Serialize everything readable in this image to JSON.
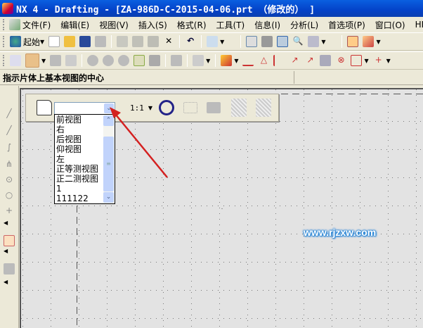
{
  "window": {
    "title": "NX 4 - Drafting - [ZA-986D-C-2015-04-06.prt （修改的） ]"
  },
  "menu": [
    "文件(F)",
    "编辑(E)",
    "视图(V)",
    "插入(S)",
    "格式(R)",
    "工具(T)",
    "信息(I)",
    "分析(L)",
    "首选项(P)",
    "窗口(O)",
    "HE"
  ],
  "toolbar": {
    "start_label": "起始"
  },
  "status": {
    "prompt": "指示片体上基本视图的中心"
  },
  "view_bar": {
    "scale": "1:1",
    "selected_view": "",
    "options": [
      "前视图",
      "右",
      "后视图",
      "仰视图",
      "左",
      "正等测视图",
      "正二测视图",
      "1",
      "111122"
    ]
  },
  "watermark": "www.rjzxw.com",
  "colors": {
    "title_bar": "#0a5fe0",
    "arrow": "#d42020",
    "canvas": "#e3e3e3"
  }
}
